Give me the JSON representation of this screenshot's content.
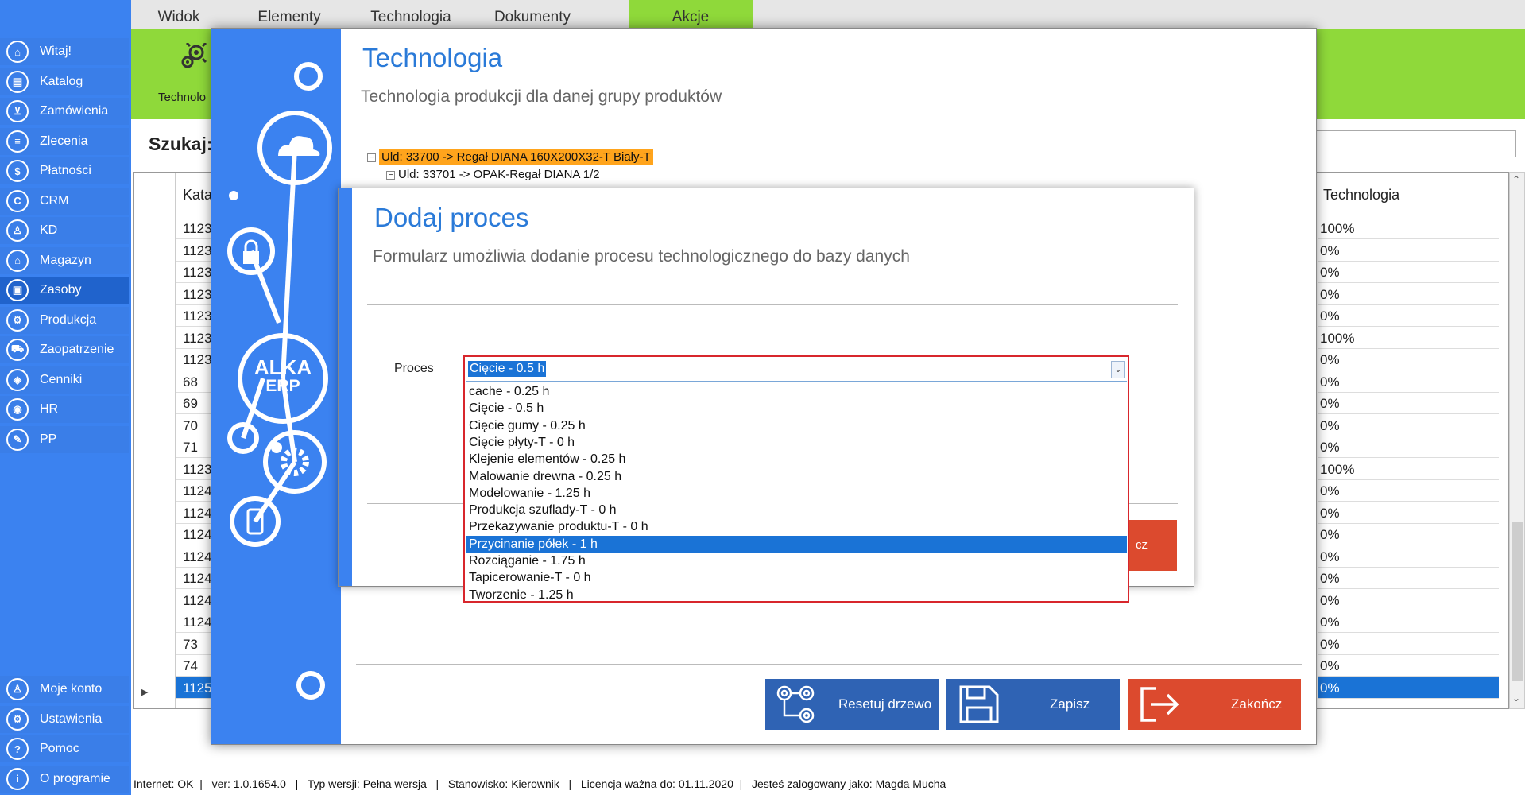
{
  "sidebar": {
    "items": [
      {
        "label": "Witaj!",
        "icon": "home-icon",
        "glyph": "⌂"
      },
      {
        "label": "Katalog",
        "icon": "book-icon",
        "glyph": "▤"
      },
      {
        "label": "Zamówienia",
        "icon": "cart-icon",
        "glyph": "⊻"
      },
      {
        "label": "Zlecenia",
        "icon": "list-icon",
        "glyph": "≡"
      },
      {
        "label": "Płatności",
        "icon": "dollar-icon",
        "glyph": "$"
      },
      {
        "label": "CRM",
        "icon": "crm-icon",
        "glyph": "C"
      },
      {
        "label": "KD",
        "icon": "user-icon",
        "glyph": "♙"
      },
      {
        "label": "Magazyn",
        "icon": "warehouse-icon",
        "glyph": "⌂"
      },
      {
        "label": "Zasoby",
        "icon": "resources-icon",
        "glyph": "▣"
      },
      {
        "label": "Produkcja",
        "icon": "production-icon",
        "glyph": "⚙"
      },
      {
        "label": "Zaopatrzenie",
        "icon": "truck-icon",
        "glyph": "⛟"
      },
      {
        "label": "Cenniki",
        "icon": "tag-icon",
        "glyph": "◈"
      },
      {
        "label": "HR",
        "icon": "hr-icon",
        "glyph": "◉"
      },
      {
        "label": "PP",
        "icon": "pp-icon",
        "glyph": "✎"
      }
    ],
    "bottom": [
      {
        "label": "Moje konto",
        "icon": "account-icon",
        "glyph": "♙"
      },
      {
        "label": "Ustawienia",
        "icon": "settings-icon",
        "glyph": "⚙"
      },
      {
        "label": "Pomoc",
        "icon": "help-icon",
        "glyph": "?"
      },
      {
        "label": "O programie",
        "icon": "info-icon",
        "glyph": "i"
      }
    ]
  },
  "menu": {
    "tabs": [
      "Widok",
      "Elementy",
      "Technologia",
      "Dokumenty",
      "Akcje"
    ],
    "active": "Akcje"
  },
  "ribbon": {
    "label": "Technolo"
  },
  "search": {
    "label": "Szukaj:"
  },
  "table": {
    "header_left": "Kata",
    "header_right": "Technologia",
    "left_values": [
      "1123",
      "1123",
      "1123",
      "1123",
      "1123",
      "1123",
      "1123",
      "68",
      "69",
      "70",
      "71",
      "1123",
      "1124",
      "1124",
      "1124",
      "1124",
      "1124",
      "1124",
      "1124",
      "73",
      "74",
      "1125"
    ],
    "right_values": [
      "100%",
      "0%",
      "0%",
      "0%",
      "0%",
      "100%",
      "0%",
      "0%",
      "0%",
      "0%",
      "0%",
      "100%",
      "0%",
      "0%",
      "0%",
      "0%",
      "0%",
      "0%",
      "0%",
      "0%",
      "0%",
      "0%"
    ]
  },
  "status": "Internet: OK  |   ver: 1.0.1654.0   |   Typ wersji: Pełna wersja   |   Stanowisko: Kierownik   |   Licencja ważna do: 01.11.2020  |   Jesteś zalogowany jako: Magda Mucha",
  "tech_window": {
    "title": "Technologia",
    "subtitle": "Technologia produkcji dla danej grupy produktów",
    "logo_line1": "ALKA",
    "logo_line2": "ERP",
    "tree": {
      "node1": "Uld: 33700 -> Regał DIANA 160X200X32-T Biały-T",
      "node2": "Uld: 33701 -> OPAK-Regał DIANA    1/2"
    },
    "buttons": {
      "reset": "Resetuj drzewo",
      "save": "Zapisz",
      "end": "Zakończ"
    }
  },
  "proc_dialog": {
    "title": "Dodaj proces",
    "subtitle": "Formularz umożliwia dodanie procesu technologicznego do bazy danych",
    "label": "Proces",
    "peek_button": "cz",
    "combo_value": "Cięcie - 0.5 h",
    "options": [
      "cache - 0.25 h",
      "Cięcie - 0.5 h",
      "Cięcie gumy - 0.25 h",
      "Cięcie płyty-T - 0 h",
      "Klejenie elementów - 0.25 h",
      "Malowanie drewna - 0.25 h",
      "Modelowanie - 1.25 h",
      "Produkcja szuflady-T - 0 h",
      "Przekazywanie produktu-T - 0 h",
      "Przycinanie półek - 1 h",
      "Rozciąganie - 1.75 h",
      "Tapicerowanie-T - 0 h",
      "Tworzenie - 1.25 h"
    ],
    "highlighted_option": "Przycinanie półek - 1 h"
  },
  "colors": {
    "accent_blue": "#3b82f0",
    "ribbon_green": "#8fd93a",
    "danger_red": "#dc4a2e",
    "highlight_orange": "#ffa41c",
    "selection_blue": "#1a73d6"
  }
}
